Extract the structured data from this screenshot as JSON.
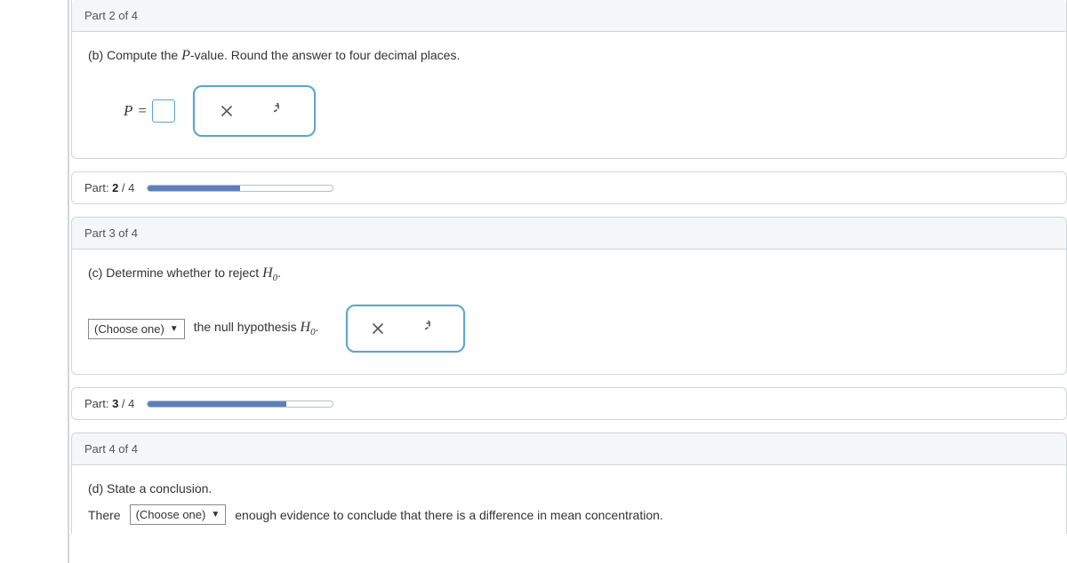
{
  "part2": {
    "header": "Part 2 of 4",
    "instruction_prefix": "(b) Compute the ",
    "instruction_var": "P",
    "instruction_suffix": "-value. Round the answer to four decimal places.",
    "eq_lhs": "P",
    "eq_op": "="
  },
  "progress2": {
    "label_prefix": "Part: ",
    "current": "2",
    "sep": " / ",
    "total": "4",
    "fill_pct": 50
  },
  "part3": {
    "header": "Part 3 of 4",
    "instruction_prefix": "(c)  Determine whether to reject ",
    "h_label": "H",
    "h_sub": "0",
    "period": ".",
    "choose_label": "(Choose one)",
    "after_select": " the null hypothesis "
  },
  "progress3": {
    "label_prefix": "Part: ",
    "current": "3",
    "sep": " / ",
    "total": "4",
    "fill_pct": 75
  },
  "part4": {
    "header": "Part 4 of 4",
    "instruction": "(d) State a conclusion.",
    "line_prefix": "There ",
    "choose_label": "(Choose one)",
    "line_suffix": " enough evidence to conclude that there is a difference in mean concentration."
  },
  "icons": {
    "clear": "clear",
    "undo": "undo"
  }
}
